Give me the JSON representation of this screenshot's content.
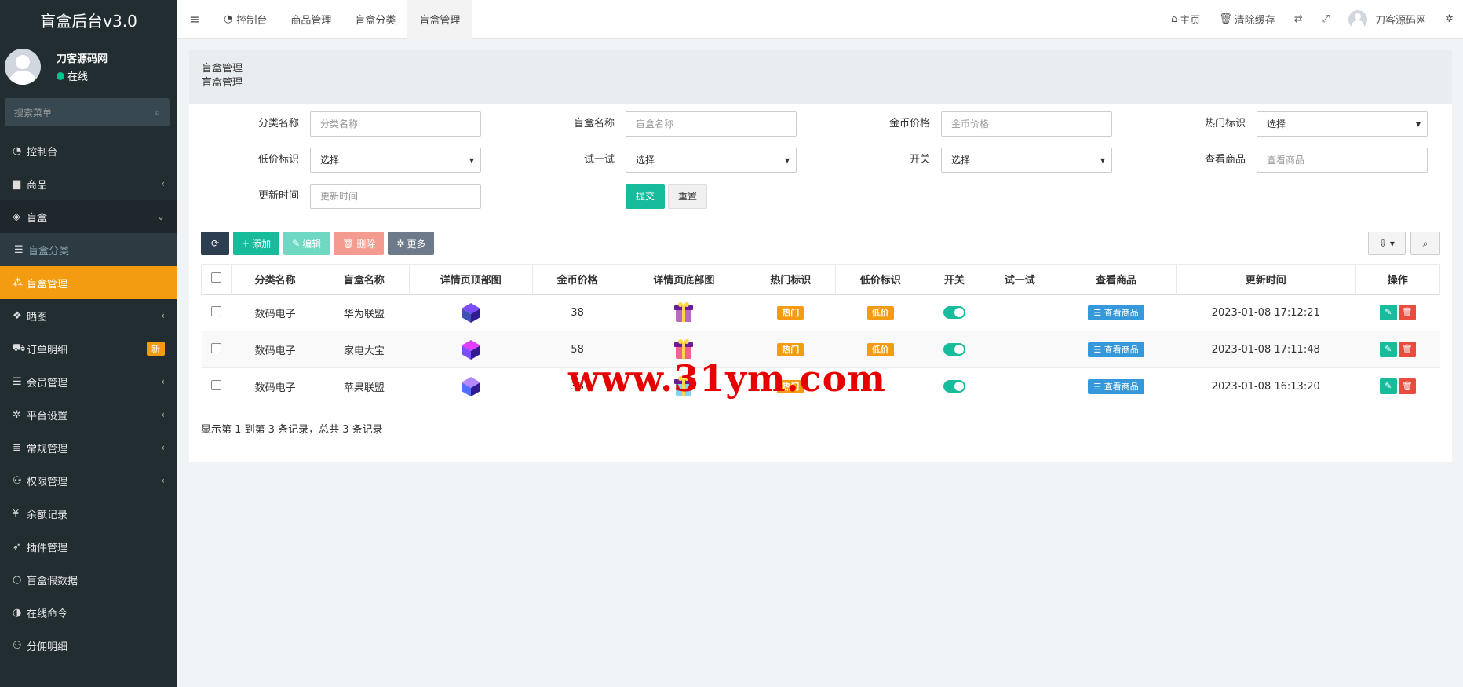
{
  "brand": "盲盒后台v3.0",
  "user": {
    "name": "刀客源码网",
    "status": "在线"
  },
  "sidebar_search_placeholder": "搜索菜单",
  "menu": [
    {
      "label": "控制台",
      "icon": "dashboard-icon",
      "glyph": "◔"
    },
    {
      "label": "商品",
      "icon": "shopping-bag-icon",
      "glyph": "▆",
      "arrow": "‹"
    },
    {
      "label": "盲盒",
      "icon": "cube-icon",
      "glyph": "◈",
      "arrow": "⌄"
    },
    {
      "label": "盲盒分类",
      "icon": "list-icon",
      "glyph": "☰"
    },
    {
      "label": "盲盒管理",
      "icon": "cubes-icon",
      "glyph": "⁂"
    },
    {
      "label": "晒图",
      "icon": "dropbox-icon",
      "glyph": "❖",
      "arrow": "‹"
    },
    {
      "label": "订单明细",
      "icon": "cart-icon",
      "glyph": "⛟",
      "badge": "新"
    },
    {
      "label": "会员管理",
      "icon": "list-icon",
      "glyph": "☰",
      "arrow": "‹"
    },
    {
      "label": "平台设置",
      "icon": "gear-icon",
      "glyph": "✲",
      "arrow": "‹"
    },
    {
      "label": "常规管理",
      "icon": "database-icon",
      "glyph": "≣",
      "arrow": "‹"
    },
    {
      "label": "权限管理",
      "icon": "group-icon",
      "glyph": "⚇",
      "arrow": "‹"
    },
    {
      "label": "余额记录",
      "icon": "yen-icon",
      "glyph": "¥"
    },
    {
      "label": "插件管理",
      "icon": "rocket-icon",
      "glyph": "➶"
    },
    {
      "label": "盲盒假数据",
      "icon": "circle-icon",
      "glyph": "○"
    },
    {
      "label": "在线命令",
      "icon": "adjust-icon",
      "glyph": "◑"
    },
    {
      "label": "分佣明细",
      "icon": "group-icon",
      "glyph": "⚇"
    }
  ],
  "topnav": {
    "tabs": [
      "控制台",
      "商品管理",
      "盲盒分类",
      "盲盒管理"
    ],
    "home": "主页",
    "clear_cache": "清除缓存",
    "username": "刀客源码网"
  },
  "panel": {
    "title": "盲盒管理",
    "subtitle": "盲盒管理"
  },
  "filters": {
    "category_label": "分类名称",
    "category_placeholder": "分类名称",
    "name_label": "盲盒名称",
    "name_placeholder": "盲盒名称",
    "price_label": "金币价格",
    "price_placeholder": "金币价格",
    "hot_label": "热门标识",
    "hot_value": "选择",
    "low_label": "低价标识",
    "low_value": "选择",
    "try_label": "试一试",
    "try_value": "选择",
    "switch_label": "开关",
    "switch_value": "选择",
    "view_label": "查看商品",
    "view_placeholder": "查看商品",
    "time_label": "更新时间",
    "time_placeholder": "更新时间",
    "submit": "提交",
    "reset": "重置"
  },
  "toolbar": {
    "add": "添加",
    "edit": "编辑",
    "delete": "删除",
    "more": "更多"
  },
  "table": {
    "headers": [
      "分类名称",
      "盲盒名称",
      "详情页顶部图",
      "金币价格",
      "详情页底部图",
      "热门标识",
      "低价标识",
      "开关",
      "试一试",
      "查看商品",
      "更新时间",
      "操作"
    ],
    "rows": [
      {
        "category": "数码电子",
        "name": "华为联盟",
        "price": "38",
        "hot": "热门",
        "low": "低价",
        "view": "查看商品",
        "time": "2023-01-08 17:12:21"
      },
      {
        "category": "数码电子",
        "name": "家电大宝",
        "price": "58",
        "hot": "热门",
        "low": "低价",
        "view": "查看商品",
        "time": "2023-01-08 17:11:48"
      },
      {
        "category": "数码电子",
        "name": "苹果联盟",
        "price": "38",
        "hot": "热门",
        "low": "",
        "view": "查看商品",
        "time": "2023-01-08 16:13:20"
      }
    ]
  },
  "summary": "显示第 1 到第 3 条记录，总共 3 条记录",
  "watermark": "www.31ym.com",
  "colors": {
    "sidebar": "#222d32",
    "active": "#f39c12",
    "primary": "#18bc9c",
    "danger": "#e74c3c",
    "info": "#3498db"
  }
}
